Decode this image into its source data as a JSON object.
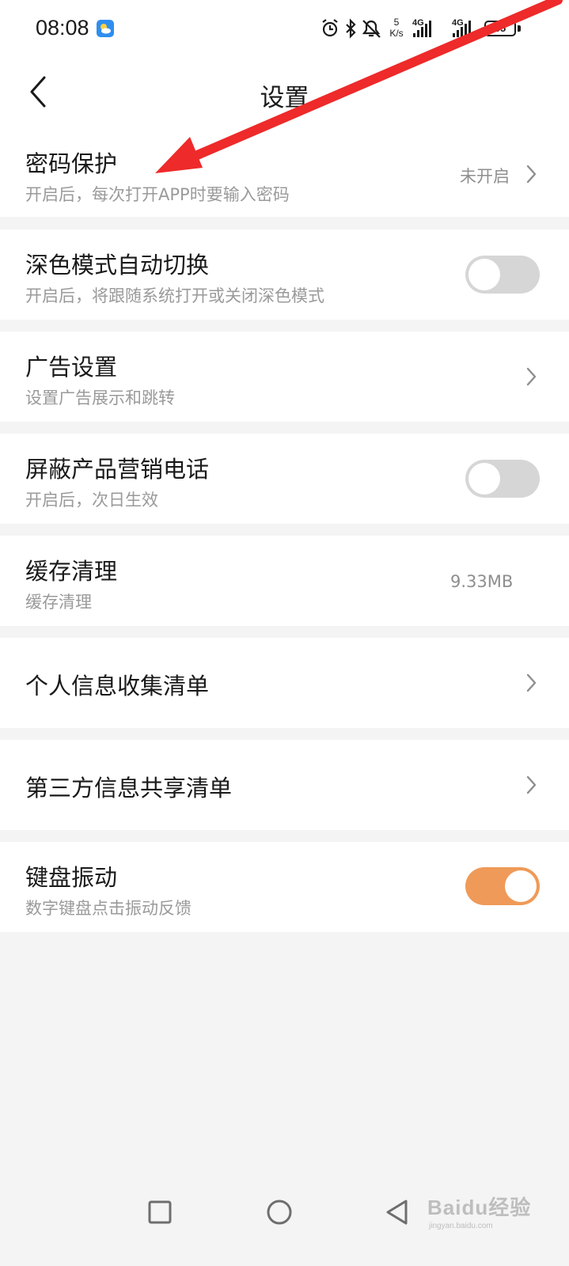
{
  "status_bar": {
    "time": "08:08",
    "net_speed_value": "5",
    "net_speed_unit": "K/s",
    "sim1_label": "4G",
    "sim2_label": "4G",
    "battery": "55"
  },
  "header": {
    "title": "设置"
  },
  "settings": [
    {
      "title": "密码保护",
      "subtitle": "开启后，每次打开APP时要输入密码",
      "value": "未开启",
      "control": "chevron"
    },
    {
      "title": "深色模式自动切换",
      "subtitle": "开启后，将跟随系统打开或关闭深色模式",
      "control": "toggle",
      "state": "off"
    },
    {
      "title": "广告设置",
      "subtitle": "设置广告展示和跳转",
      "control": "chevron"
    },
    {
      "title": "屏蔽产品营销电话",
      "subtitle": "开启后，次日生效",
      "control": "toggle",
      "state": "off"
    },
    {
      "title": "缓存清理",
      "subtitle": "缓存清理",
      "value": "9.33MB",
      "control": "none"
    },
    {
      "title": "个人信息收集清单",
      "control": "chevron"
    },
    {
      "title": "第三方信息共享清单",
      "control": "chevron"
    },
    {
      "title": "键盘振动",
      "subtitle": "数字键盘点击振动反馈",
      "control": "toggle",
      "state": "on"
    }
  ],
  "colors": {
    "toggle_on": "#ef9a58",
    "toggle_off": "#d6d6d6",
    "annotation_arrow": "#ee2a2a",
    "background": "#f4f4f4"
  },
  "watermark": {
    "text": "Baidu经验",
    "url": "jingyan.baidu.com"
  }
}
